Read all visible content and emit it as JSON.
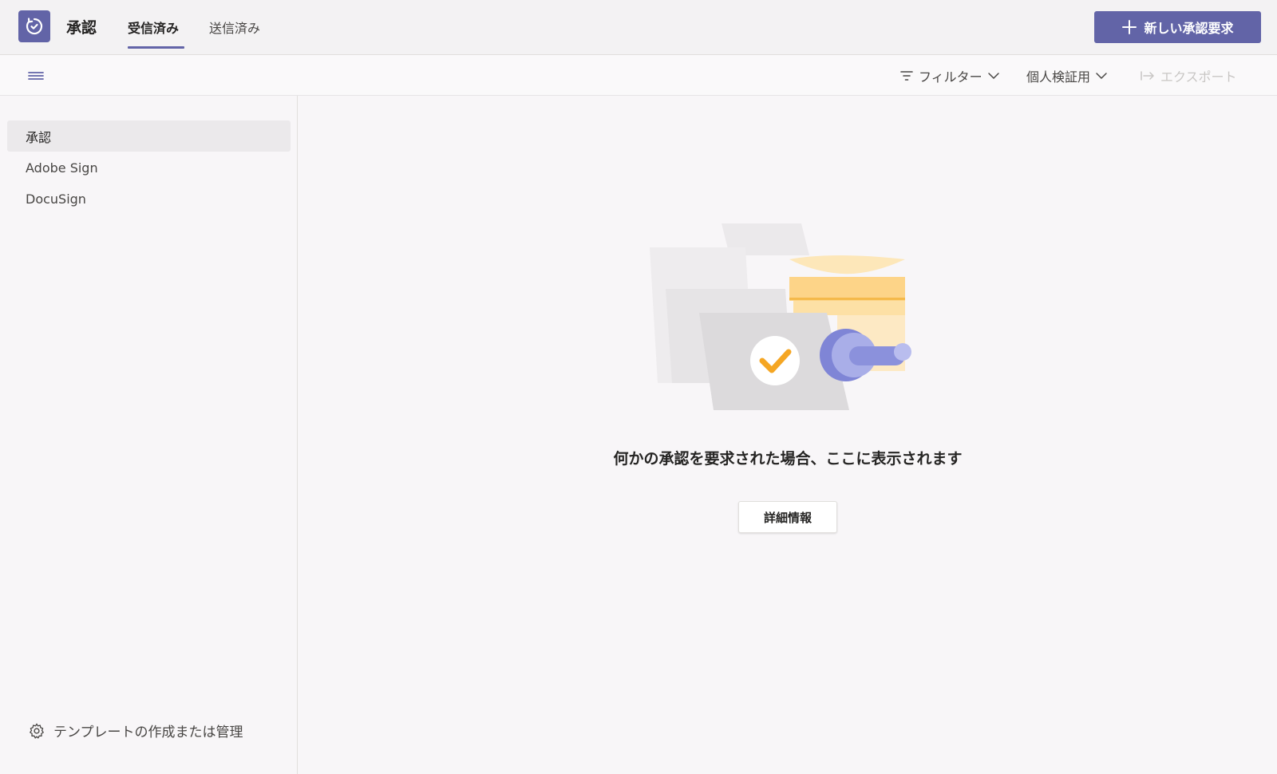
{
  "app": {
    "title": "承認",
    "icon": "approvals-app-icon",
    "accent_color": "#6264a7"
  },
  "tabs": [
    {
      "label": "受信済み",
      "active": true
    },
    {
      "label": "送信済み",
      "active": false
    }
  ],
  "header": {
    "new_request_label": "新しい承認要求",
    "new_request_icon": "plus-icon"
  },
  "toolbar": {
    "menu_icon": "hamburger-icon",
    "filter_label": "フィルター",
    "environment_label": "個人検証用",
    "export_label": "エクスポート",
    "export_enabled": false
  },
  "sidebar": {
    "items": [
      {
        "label": "承認",
        "selected": true
      },
      {
        "label": "Adobe Sign",
        "selected": false
      },
      {
        "label": "DocuSign",
        "selected": false
      }
    ],
    "manage_templates_label": "テンプレートの作成または管理",
    "manage_templates_icon": "gear-icon"
  },
  "main": {
    "empty_message": "何かの承認を要求された場合、ここに表示されます",
    "details_button_label": "詳細情報",
    "illustration": "approval-documents-illustration"
  }
}
